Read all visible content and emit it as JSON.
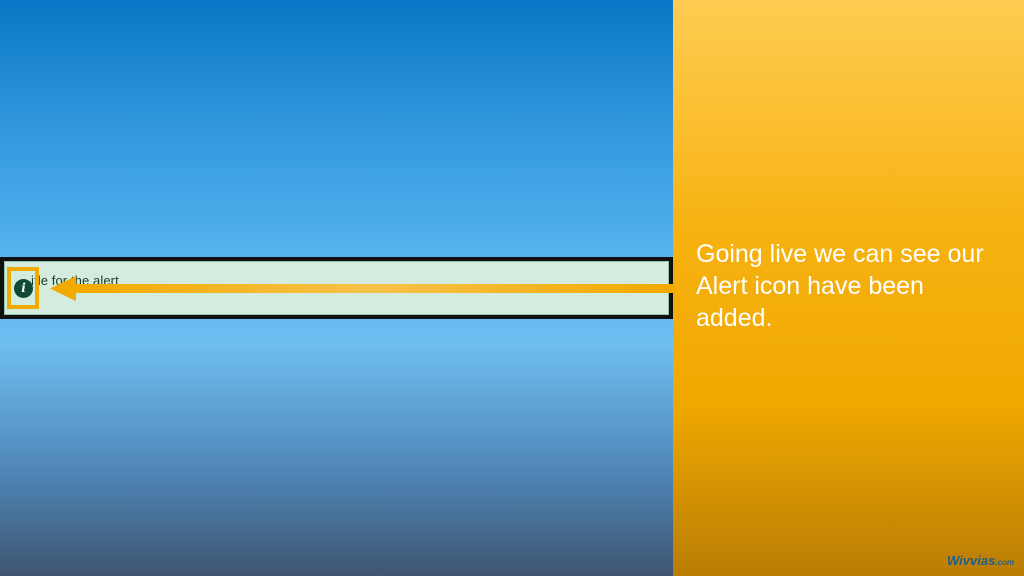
{
  "slide": {
    "caption": "Going live we can see our Alert icon have been added."
  },
  "alert": {
    "title": "itle for the alert",
    "icon": "info-icon",
    "icon_glyph": "i",
    "background_color": "#d4ecdd"
  },
  "callout": {
    "arrow_color": "#f2a900",
    "highlight_color": "#f2a900"
  },
  "brand": {
    "name": "Wivvias",
    "suffix": ".com"
  }
}
